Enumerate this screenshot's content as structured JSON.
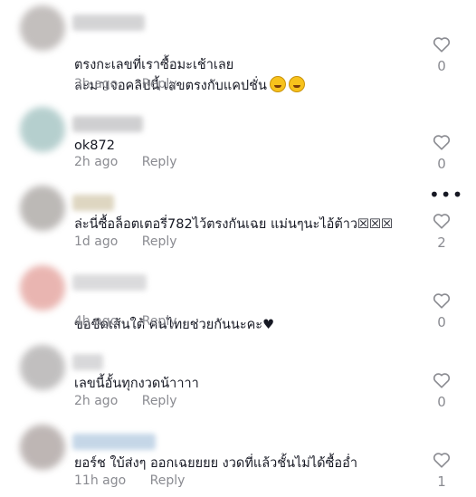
{
  "comments": [
    {
      "text": "ตรงกะเลขที่เราซื้อมะเช้าเลย\nละมาเจอคลิปนี้ เลขตรงกับแคปชั่น",
      "emoji": [
        "rolling-on-floor-laughing-emoji",
        "rolling-on-floor-laughing-emoji"
      ],
      "time": "3h ago",
      "reply": "Reply",
      "likes": "0",
      "avatar_color": "#b9b4b2",
      "name_color": "#c9c9cb"
    },
    {
      "text": "ok872",
      "time": "2h ago",
      "reply": "Reply",
      "likes": "0",
      "avatar_color": "#a9c7c6",
      "name_color": "#c4c4c6"
    },
    {
      "text": "ล่ะนี่ซื้อล็อตเตอรี่782ไว้ตรงกันเฉย แม่นๆนะไอ้ต้าว☒☒☒",
      "time": "1d ago",
      "reply": "Reply",
      "likes": "2",
      "avatar_color": "#b1adaa",
      "name_color": "#d6ccb2"
    },
    {
      "text": "ขอขีดเส้นใต้ คนไทยช่วยกันนะคะ",
      "heart": "♥",
      "time": "4h ago",
      "reply": "Reply",
      "likes": "0",
      "avatar_color": "#e6a9a4",
      "name_color": "#d2d2d4"
    },
    {
      "text": "เลขนี้อั้นทุกงวดน้าาาา",
      "time": "2h ago",
      "reply": "Reply",
      "likes": "0",
      "avatar_color": "#b7b5b5",
      "name_color": "#cfcfd1"
    },
    {
      "text": "ยอร์ช ใบ้ส่งๆ ออกเฉยยยย งวดที่แล้วชั้นไม่ได้ซื้ออ่ำ",
      "time": "11h ago",
      "reply": "Reply",
      "likes": "1",
      "avatar_color": "#b3aaa8",
      "name_color": "#b7cde2"
    }
  ],
  "more_options": "•••"
}
